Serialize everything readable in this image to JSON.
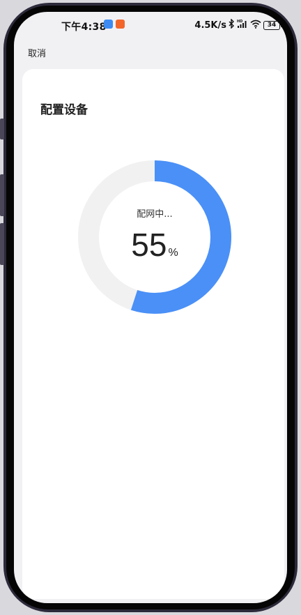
{
  "status_bar": {
    "time": "下午4:38",
    "network_speed": "4.5K/s",
    "battery_level": "34",
    "icons": [
      "bluetooth-icon",
      "signal-hd-icon",
      "wifi-icon",
      "battery-icon"
    ],
    "app_badges": [
      "blue-app-badge-icon",
      "orange-app-badge-icon"
    ]
  },
  "nav": {
    "cancel_label": "取消"
  },
  "card": {
    "title": "配置设备"
  },
  "progress": {
    "status_text": "配网中...",
    "percent": "55",
    "percent_sign": "%",
    "fraction": 0.55
  },
  "colors": {
    "accent": "#4a90f7",
    "track": "#f1f1f2",
    "screen_bg": "#f1f1f4",
    "card_bg": "#ffffff"
  }
}
